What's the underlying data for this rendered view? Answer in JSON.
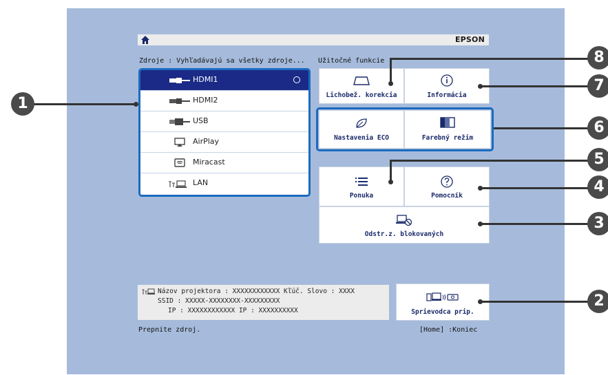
{
  "topbar": {
    "brand": "EPSON",
    "home_icon": "home-icon"
  },
  "labels": {
    "sources_heading": "Zdroje : Vyhľadávajú sa všetky zdroje...",
    "functions_heading": "Užitočné funkcie :"
  },
  "sources": [
    {
      "name": "HDMI1",
      "icon": "hdmi-icon",
      "selected": true
    },
    {
      "name": "HDMI2",
      "icon": "hdmi-icon",
      "selected": false
    },
    {
      "name": "USB",
      "icon": "usb-icon",
      "selected": false
    },
    {
      "name": "AirPlay",
      "icon": "airplay-icon",
      "selected": false
    },
    {
      "name": "Miracast",
      "icon": "miracast-icon",
      "selected": false
    },
    {
      "name": "LAN",
      "icon": "lan-icon",
      "selected": false
    }
  ],
  "functions": {
    "keystone": "Lichobež. korekcia",
    "info": "Informácia",
    "eco": "Nastavenia ECO",
    "color_mode": "Farebný režim",
    "menu": "Ponuka",
    "help": "Pomocník",
    "unblock": "Odstr.z. blokovaných",
    "wizard": "Sprievodca prip."
  },
  "info": {
    "line1": "Názov projektora : XXXXXXXXXXXX  Kľúč. Slovo : XXXX",
    "line2": "SSID  : XXXXX-XXXXXXXX-XXXXXXXXX",
    "line3": "IP : XXXXXXXXXXXX   IP : XXXXXXXXXX"
  },
  "footer": {
    "left": "Prepnite zdroj.",
    "right": "[Home] :Koniec"
  },
  "callouts": [
    "1",
    "2",
    "3",
    "4",
    "5",
    "6",
    "7",
    "8"
  ],
  "colors": {
    "screen_bg": "#a6bbdb",
    "highlight_border": "#1b6bbf",
    "selected_row": "#1a2a86",
    "badge": "#4a4a4a"
  }
}
